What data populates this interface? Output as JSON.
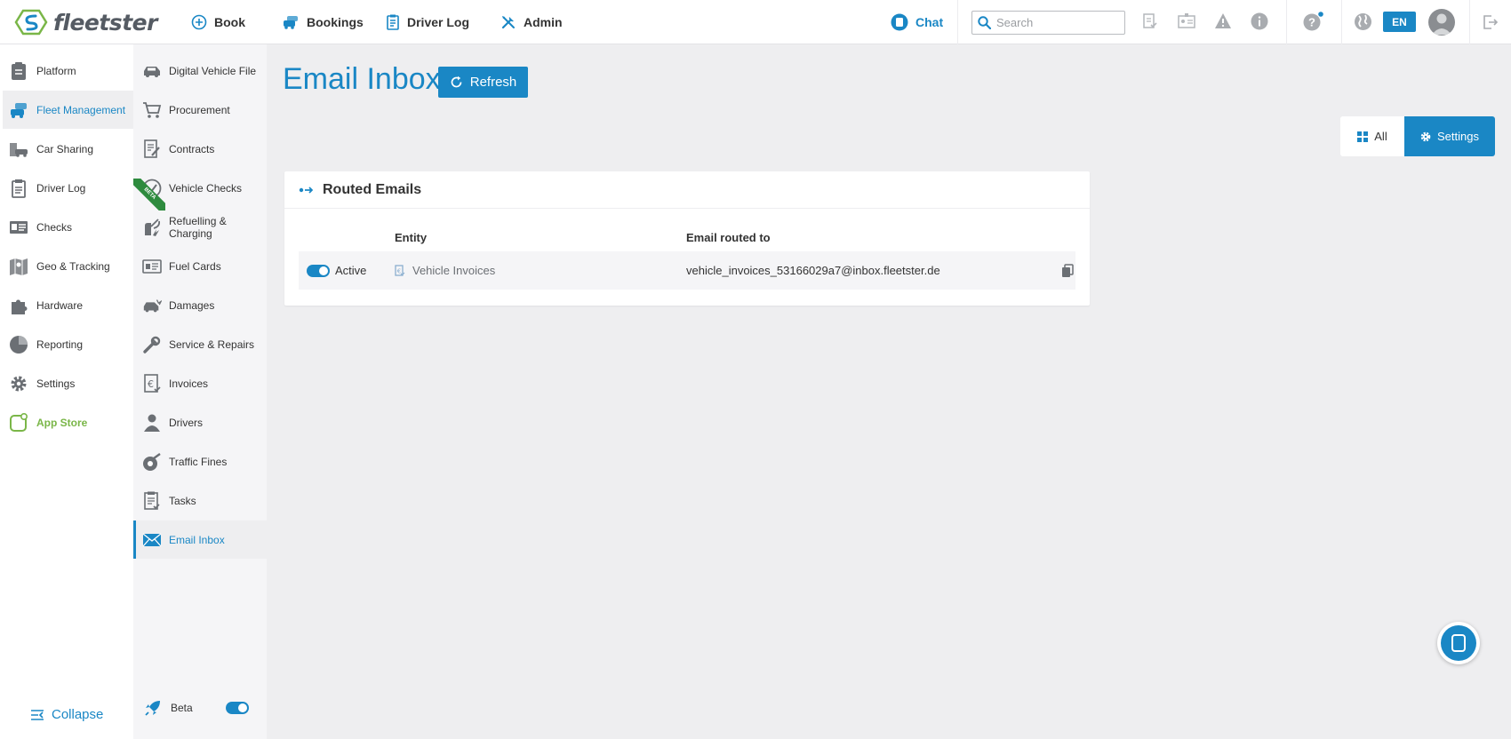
{
  "app": {
    "name": "fleetster"
  },
  "topnav": {
    "book": "Book",
    "bookings": "Bookings",
    "driver_log": "Driver Log",
    "admin": "Admin",
    "chat": "Chat",
    "search_placeholder": "Search",
    "language": "EN"
  },
  "sidebar": {
    "items": [
      {
        "label": "Platform",
        "icon": "clipboard-icon"
      },
      {
        "label": "Fleet Management",
        "icon": "fleet-cars-icon",
        "active": true
      },
      {
        "label": "Car Sharing",
        "icon": "car-sharing-icon"
      },
      {
        "label": "Driver Log",
        "icon": "logbook-icon"
      },
      {
        "label": "Checks",
        "icon": "id-card-icon"
      },
      {
        "label": "Geo & Tracking",
        "icon": "map-icon"
      },
      {
        "label": "Hardware",
        "icon": "puzzle-icon"
      },
      {
        "label": "Reporting",
        "icon": "pie-chart-icon"
      },
      {
        "label": "Settings",
        "icon": "gear-icon"
      },
      {
        "label": "App Store",
        "icon": "app-store-icon"
      }
    ],
    "collapse": "Collapse"
  },
  "subnav": {
    "items": [
      {
        "label": "Digital Vehicle File",
        "icon": "car-icon"
      },
      {
        "label": "Procurement",
        "icon": "cart-icon"
      },
      {
        "label": "Contracts",
        "icon": "contract-icon"
      },
      {
        "label": "Vehicle Checks",
        "icon": "check-circle-icon",
        "badge": "BETA"
      },
      {
        "label": "Refuelling & Charging",
        "icon": "fuel-icon"
      },
      {
        "label": "Fuel Cards",
        "icon": "fuel-card-icon"
      },
      {
        "label": "Damages",
        "icon": "damaged-car-icon"
      },
      {
        "label": "Service & Repairs",
        "icon": "wrench-icon"
      },
      {
        "label": "Invoices",
        "icon": "invoice-icon"
      },
      {
        "label": "Drivers",
        "icon": "driver-icon"
      },
      {
        "label": "Traffic Fines",
        "icon": "traffic-fine-icon"
      },
      {
        "label": "Tasks",
        "icon": "tasks-icon"
      },
      {
        "label": "Email Inbox",
        "icon": "envelope-icon",
        "active": true
      }
    ],
    "beta_label": "Beta"
  },
  "main": {
    "title": "Email Inbox",
    "refresh_label": "Refresh",
    "view_all": "All",
    "view_settings": "Settings",
    "card": {
      "title": "Routed Emails",
      "columns": {
        "entity": "Entity",
        "email": "Email routed to"
      },
      "rows": [
        {
          "status": "Active",
          "entity": "Vehicle Invoices",
          "email": "vehicle_invoices_53166029a7@inbox.fleetster.de"
        }
      ]
    }
  },
  "colors": {
    "accent": "#1a87c5",
    "app_store": "#7ab648",
    "beta": "#2e8b3e"
  }
}
